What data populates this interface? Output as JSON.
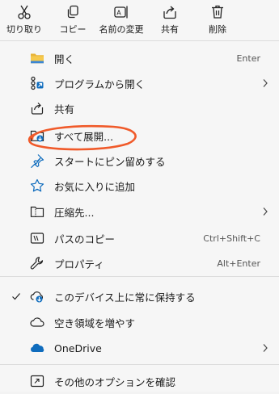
{
  "toolbar": {
    "cut": "切り取り",
    "copy": "コピー",
    "rename": "名前の変更",
    "share": "共有",
    "delete": "削除"
  },
  "items": {
    "open": "開く",
    "open_shortcut": "Enter",
    "open_with": "プログラムから開く",
    "share": "共有",
    "extract_all": "すべて展開...",
    "pin_start": "スタートにピン留めする",
    "favorites": "お気に入りに追加",
    "compress": "圧縮先...",
    "copy_path": "パスのコピー",
    "copy_path_shortcut": "Ctrl+Shift+C",
    "properties": "プロパティ",
    "properties_shortcut": "Alt+Enter",
    "keep_on_device": "このデバイス上に常に保持する",
    "free_space": "空き領域を増やす",
    "onedrive": "OneDrive",
    "more_options": "その他のオプションを確認"
  },
  "colors": {
    "accent": "#0f6cbd",
    "highlight_circle": "#f05a2a",
    "folder": "#e8b53c"
  }
}
